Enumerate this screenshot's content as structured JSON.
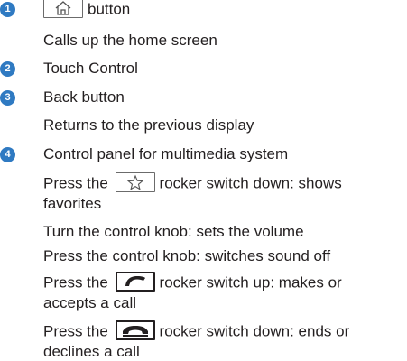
{
  "items": [
    {
      "number": "1",
      "lines": [
        "button",
        "Calls up the home screen"
      ],
      "icon": "home-icon"
    },
    {
      "number": "2",
      "lines": [
        "Touch Control"
      ]
    },
    {
      "number": "3",
      "lines": [
        "Back button",
        "Returns to the previous display"
      ]
    },
    {
      "number": "4",
      "lines": [
        "Control panel for multimedia system",
        "Press the",
        "rocker switch down: shows",
        "favorites",
        "Turn the control knob: sets the volume",
        "Press the control knob: switches sound off",
        "Press the",
        "rocker switch up: makes or",
        "accepts a call",
        "Press the",
        "rocker switch down: ends or",
        "declines a call"
      ],
      "icons": [
        "star-icon",
        "phone-accept-icon",
        "phone-end-icon"
      ]
    }
  ],
  "colors": {
    "badge": "#2f7ac2",
    "text": "#231f20"
  }
}
